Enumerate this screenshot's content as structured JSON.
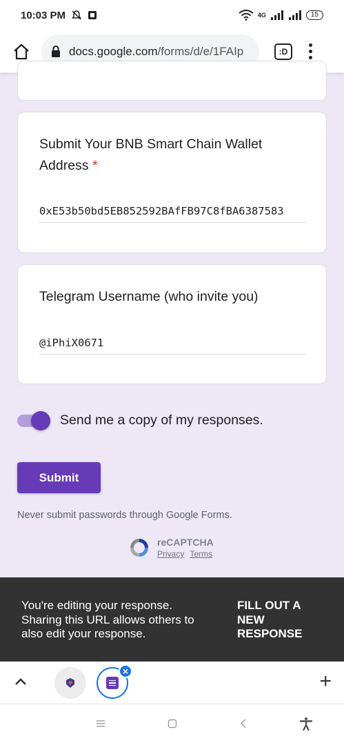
{
  "status_bar": {
    "time": "10:03 PM",
    "network": "4G",
    "battery": "15"
  },
  "browser": {
    "url_domain": "docs.google.com",
    "url_path": "/forms/d/e/1FAIp",
    "tab_switcher_label": ":D"
  },
  "form": {
    "wallet_question": {
      "title": "Submit Your BNB Smart Chain Wallet Address",
      "required_mark": "*",
      "answer": "0xE53b50bd5EB852592BAfFB97C8fBA6387583"
    },
    "telegram_question": {
      "title": "Telegram Username (who invite you)",
      "answer": "@iPhiX0671"
    },
    "copy_toggle": {
      "label": "Send me a copy of my responses.",
      "checked": true
    },
    "submit_label": "Submit",
    "warning": "Never submit passwords through Google Forms.",
    "recaptcha": {
      "title": "reCAPTCHA",
      "privacy": "Privacy",
      "terms": "Terms"
    }
  },
  "snackbar": {
    "message": "You're editing your response. Sharing this URL allows others to also edit your response.",
    "action": "FILL OUT A NEW RESPONSE"
  },
  "colors": {
    "accent": "#673ab7",
    "background": "#ede7f6",
    "required": "#d93025",
    "snackbar": "#323232",
    "tab_highlight": "#1a73e8"
  }
}
